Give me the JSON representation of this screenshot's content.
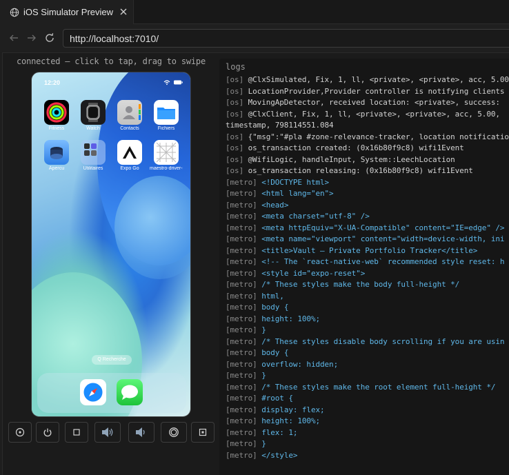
{
  "tab": {
    "title": "iOS Simulator Preview"
  },
  "nav": {
    "url": "http://localhost:7010/"
  },
  "status_text": "connected — click to tap, drag to swipe",
  "phone": {
    "time": "12:20",
    "apps": [
      {
        "label": "Fitness"
      },
      {
        "label": "Watch"
      },
      {
        "label": "Contacts"
      },
      {
        "label": "Fichiers"
      },
      {
        "label": "Apercu"
      },
      {
        "label": "Utilitaires"
      },
      {
        "label": "Expo Go"
      },
      {
        "label": "maestro-driver-i..."
      }
    ],
    "search_label": "Q Recherche",
    "dock": [
      {
        "name": "Safari"
      },
      {
        "name": "Messages"
      }
    ]
  },
  "logs": {
    "title": "logs",
    "lines": [
      {
        "tag": "[os]",
        "text": "@ClxSimulated, Fix, 1, ll, <private>, <private>, acc, 5.00",
        "kind": "os"
      },
      {
        "tag": "[os]",
        "text": "LocationProvider,Provider controller is notifying clients",
        "kind": "os"
      },
      {
        "tag": "[os]",
        "text": "MovingApDetector, received location: <private>, success: ",
        "kind": "os"
      },
      {
        "tag": "[os]",
        "text": "@ClxClient, Fix, 1, ll, <private>, <private>, acc, 5.00, ",
        "kind": "os"
      },
      {
        "tag": "",
        "text": "timestamp, 798114551.084",
        "kind": "plain"
      },
      {
        "tag": "[os]",
        "text": "{\"msg\":\"#pla #zone-relevance-tracker, location notificatio",
        "kind": "os"
      },
      {
        "tag": "[os]",
        "text": "os_transaction created: (0x16b80f9c8) wifi1Event",
        "kind": "os"
      },
      {
        "tag": "[os]",
        "text": "@WifiLogic, handleInput, System::LeechLocation",
        "kind": "os"
      },
      {
        "tag": "[os]",
        "text": "os_transaction releasing: (0x16b80f9c8) wifi1Event",
        "kind": "os"
      },
      {
        "tag": "[metro]",
        "text": "<!DOCTYPE html>",
        "kind": "metro"
      },
      {
        "tag": "[metro]",
        "text": "<html lang=\"en\">",
        "kind": "metro"
      },
      {
        "tag": "[metro]",
        "text": "<head>",
        "kind": "metro"
      },
      {
        "tag": "[metro]",
        "text": "<meta charset=\"utf-8\" />",
        "kind": "metro"
      },
      {
        "tag": "[metro]",
        "text": "<meta httpEquiv=\"X-UA-Compatible\" content=\"IE=edge\" />",
        "kind": "metro"
      },
      {
        "tag": "[metro]",
        "text": "<meta name=\"viewport\" content=\"width=device-width, ini",
        "kind": "metro"
      },
      {
        "tag": "[metro]",
        "text": "<title>Vault — Private Portfolio Tracker</title>",
        "kind": "metro"
      },
      {
        "tag": "[metro]",
        "text": "<!-- The `react-native-web` recommended style reset: h",
        "kind": "metro"
      },
      {
        "tag": "[metro]",
        "text": "<style id=\"expo-reset\">",
        "kind": "metro"
      },
      {
        "tag": "[metro]",
        "text": "/* These styles make the body full-height */",
        "kind": "metro"
      },
      {
        "tag": "[metro]",
        "text": "html,",
        "kind": "metro"
      },
      {
        "tag": "[metro]",
        "text": "body {",
        "kind": "metro"
      },
      {
        "tag": "[metro]",
        "text": "height: 100%;",
        "kind": "metro"
      },
      {
        "tag": "[metro]",
        "text": "}",
        "kind": "metro"
      },
      {
        "tag": "[metro]",
        "text": "/* These styles disable body scrolling if you are usin",
        "kind": "metro"
      },
      {
        "tag": "[metro]",
        "text": "body {",
        "kind": "metro"
      },
      {
        "tag": "[metro]",
        "text": "overflow: hidden;",
        "kind": "metro"
      },
      {
        "tag": "[metro]",
        "text": "}",
        "kind": "metro"
      },
      {
        "tag": "[metro]",
        "text": "/* These styles make the root element full-height */",
        "kind": "metro"
      },
      {
        "tag": "[metro]",
        "text": "#root {",
        "kind": "metro"
      },
      {
        "tag": "[metro]",
        "text": "display: flex;",
        "kind": "metro"
      },
      {
        "tag": "[metro]",
        "text": "height: 100%;",
        "kind": "metro"
      },
      {
        "tag": "[metro]",
        "text": "flex: 1;",
        "kind": "metro"
      },
      {
        "tag": "[metro]",
        "text": "}",
        "kind": "metro"
      },
      {
        "tag": "[metro]",
        "text": "</style>",
        "kind": "metro"
      }
    ]
  },
  "colors": {
    "accent_blue": "#5fb7e8",
    "log_text": "#d2d2d2",
    "tag_gray": "#8a8a8a"
  }
}
